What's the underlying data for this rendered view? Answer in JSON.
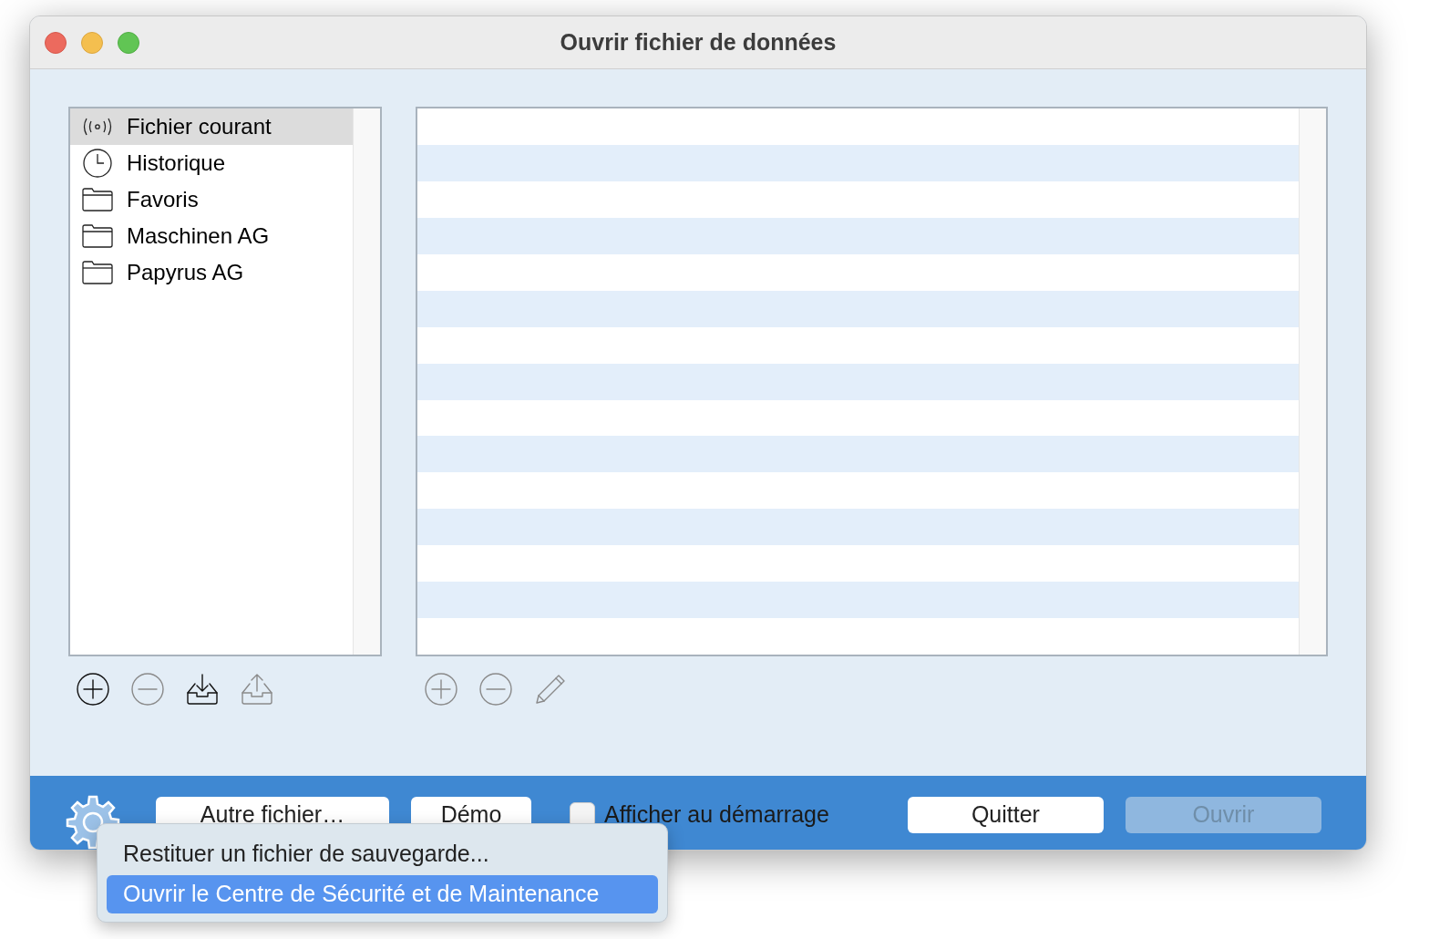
{
  "window": {
    "title": "Ouvrir fichier de données"
  },
  "sidebar": {
    "items": [
      {
        "kind": "broadcast",
        "label": "Fichier courant",
        "selected": true
      },
      {
        "kind": "clock",
        "label": "Historique",
        "selected": false
      },
      {
        "kind": "folder",
        "label": "Favoris",
        "selected": false
      },
      {
        "kind": "folder",
        "label": "Maschinen AG",
        "selected": false
      },
      {
        "kind": "folder",
        "label": "Papyrus AG",
        "selected": false
      }
    ]
  },
  "sidebar_toolbar": [
    {
      "kind": "add",
      "disabled": false
    },
    {
      "kind": "remove",
      "disabled": true
    },
    {
      "kind": "import",
      "disabled": false
    },
    {
      "kind": "export",
      "disabled": true
    }
  ],
  "list_toolbar": [
    {
      "kind": "add",
      "disabled": true
    },
    {
      "kind": "remove",
      "disabled": true
    },
    {
      "kind": "edit",
      "disabled": true
    }
  ],
  "footer": {
    "other_file": "Autre fichier…",
    "demo": "Démo",
    "show_at_startup": {
      "label": "Afficher au démarrage",
      "checked": false
    },
    "quit": "Quitter",
    "open": {
      "label": "Ouvrir",
      "disabled": true
    }
  },
  "menu": {
    "items": [
      {
        "label": "Restituer un fichier de sauvegarde...",
        "selected": false
      },
      {
        "label": "Ouvrir le Centre de Sécurité et de Maintenance",
        "selected": true
      }
    ]
  }
}
